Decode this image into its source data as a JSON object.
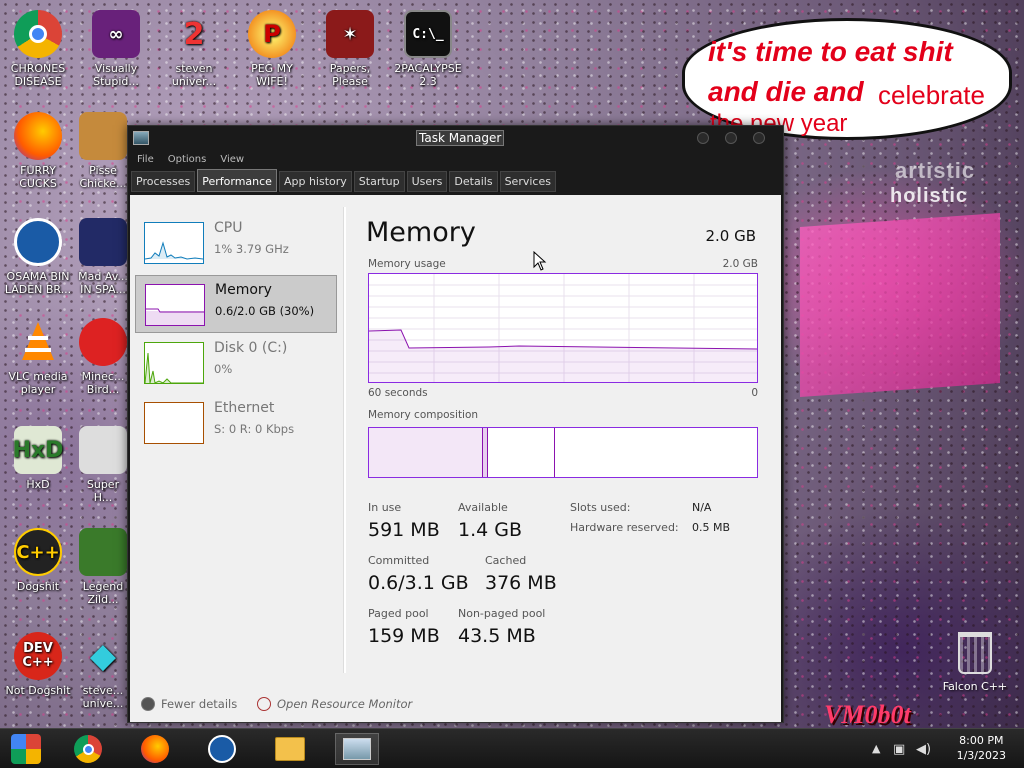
{
  "wallpaper": {
    "bubble_lines": [
      "it's time to eat shit",
      "and die and",
      "celebrate",
      "the new year"
    ],
    "billboard_text": [
      "artistic",
      "holistic"
    ],
    "watermark": "VM0b0t"
  },
  "desktop_icons": [
    {
      "label": "CHRONES DISEASE",
      "icon": "chrome-icon"
    },
    {
      "label": "Visually Stupid...",
      "icon": "visual-studio-icon"
    },
    {
      "label": "steven univer...",
      "icon": "steven-universe-icon"
    },
    {
      "label": "PEG MY WIFE!",
      "icon": "peggle-icon"
    },
    {
      "label": "Papers, Please",
      "icon": "papers-please-icon"
    },
    {
      "label": "2PACALYPSE 2.3",
      "icon": "terminal-icon"
    },
    {
      "label": "FURRY CUCKS",
      "icon": "firefox-icon"
    },
    {
      "label": "Pisse Chicke...",
      "icon": "chicken-icon"
    },
    {
      "label": "OSAMA BIN LADEN BR...",
      "icon": "obama-logo-icon"
    },
    {
      "label": "Mad Av... IN SPA...",
      "icon": "angry-birds-space-icon"
    },
    {
      "label": "VLC media player",
      "icon": "vlc-icon"
    },
    {
      "label": "Minec... Bird...",
      "icon": "angry-bird-icon"
    },
    {
      "label": "HxD",
      "icon": "hxd-icon"
    },
    {
      "label": "Super H...",
      "icon": "super-hot-icon"
    },
    {
      "label": "Dogshit",
      "icon": "dogshit-icon"
    },
    {
      "label": "Legend Zild...",
      "icon": "zelda-icon"
    },
    {
      "label": "Not Dogshit",
      "icon": "dev-cpp-icon"
    },
    {
      "label": "steve... unive...",
      "icon": "diamond-icon"
    }
  ],
  "recycle_bin": {
    "label": "Falcon C++"
  },
  "taskmanager": {
    "title": "Task Manager",
    "menu": [
      "File",
      "Options",
      "View"
    ],
    "tabs": [
      "Processes",
      "Performance",
      "App history",
      "Startup",
      "Users",
      "Details",
      "Services"
    ],
    "active_tab": "Performance",
    "side": [
      {
        "name": "CPU",
        "value": "1% 3.79 GHz"
      },
      {
        "name": "Memory",
        "value": "0.6/2.0 GB (30%)"
      },
      {
        "name": "Disk 0 (C:)",
        "value": "0%"
      },
      {
        "name": "Ethernet",
        "value": "S: 0 R: 0 Kbps"
      }
    ],
    "main": {
      "title": "Memory",
      "total": "2.0 GB",
      "usage_label": "Memory usage",
      "usage_max": "2.0 GB",
      "time_left": "60 seconds",
      "time_right": "0",
      "composition_label": "Memory composition",
      "stats": {
        "in_use_label": "In use",
        "in_use": "591 MB",
        "available_label": "Available",
        "available": "1.4 GB",
        "committed_label": "Committed",
        "committed": "0.6/3.1 GB",
        "cached_label": "Cached",
        "cached": "376 MB",
        "paged_label": "Paged pool",
        "paged": "159 MB",
        "nonpaged_label": "Non-paged pool",
        "nonpaged": "43.5 MB"
      },
      "meta": {
        "slots_label": "Slots used:",
        "slots": "N/A",
        "hw_label": "Hardware reserved:",
        "hw": "0.5 MB"
      }
    },
    "footer": {
      "fewer": "Fewer details",
      "resmon": "Open Resource Monitor"
    }
  },
  "taskbar": {
    "time": "8:00 PM",
    "date": "1/3/2023",
    "pinned": [
      "start-icon",
      "chrome-icon",
      "firefox-icon",
      "obama-logo-icon",
      "file-explorer-icon",
      "task-manager-icon"
    ]
  },
  "colors": {
    "memory_accent": "#8b12ae",
    "cpu_accent": "#117dbb",
    "disk_accent": "#4da60c",
    "ethernet_accent": "#a74f01"
  }
}
